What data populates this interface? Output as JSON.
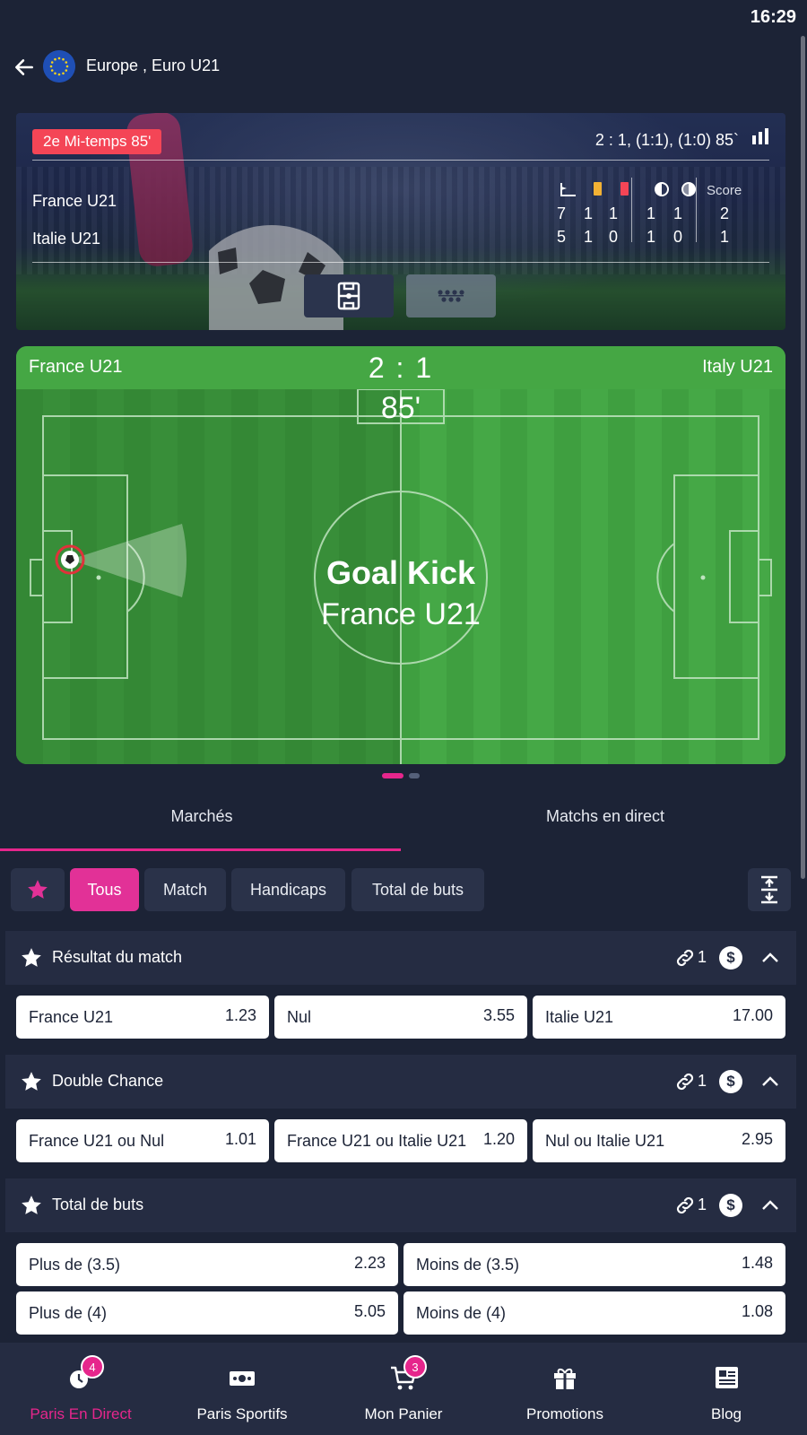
{
  "status_bar": {
    "time": "16:29"
  },
  "nav": {
    "title": "Europe , Euro U21"
  },
  "scoreboard": {
    "period": "2e Mi-temps 85'",
    "score_summary": "2 : 1, (1:1), (1:0) 85`",
    "home_team": "France U21",
    "away_team": "Italie U21",
    "score_header": "Score",
    "home_stats": [
      "7",
      "1",
      "1",
      "1",
      "1",
      "2"
    ],
    "away_stats": [
      "5",
      "1",
      "0",
      "1",
      "0",
      "1"
    ],
    "colors": {
      "period_badge": "#f44556",
      "yellow_card": "#f2b134",
      "red_card": "#f44556"
    }
  },
  "pitch": {
    "home_team": "France U21",
    "away_team": "Italy U21",
    "score": "2 : 1",
    "minute": "85'",
    "event_title": "Goal Kick",
    "event_team": "France U21"
  },
  "tabs": {
    "markets": "Marchés",
    "live_matches": "Matchs en direct"
  },
  "filters": {
    "all": "Tous",
    "match": "Match",
    "handicaps": "Handicaps",
    "total_goals": "Total de buts"
  },
  "markets": [
    {
      "title": "Résultat du match",
      "link_count": "1",
      "odds": [
        {
          "label": "France U21",
          "value": "1.23"
        },
        {
          "label": "Nul",
          "value": "3.55"
        },
        {
          "label": "Italie U21",
          "value": "17.00"
        }
      ]
    },
    {
      "title": "Double Chance",
      "link_count": "1",
      "odds": [
        {
          "label": "France U21 ou Nul",
          "value": "1.01"
        },
        {
          "label": "France U21 ou Italie U21",
          "value": "1.20"
        },
        {
          "label": "Nul ou Italie U21",
          "value": "2.95"
        }
      ]
    },
    {
      "title": "Total de buts",
      "link_count": "1",
      "odds": [
        {
          "label": "Plus de (3.5)",
          "value": "2.23"
        },
        {
          "label": "Moins de (3.5)",
          "value": "1.48"
        },
        {
          "label": "Plus de (4)",
          "value": "5.05"
        },
        {
          "label": "Moins de (4)",
          "value": "1.08"
        }
      ]
    }
  ],
  "bottom_nav": [
    {
      "label": "Paris En Direct",
      "badge": "4",
      "icon": "live-bets-icon"
    },
    {
      "label": "Paris Sportifs",
      "badge": "",
      "icon": "sports-bets-icon"
    },
    {
      "label": "Mon Panier",
      "badge": "3",
      "icon": "cart-icon"
    },
    {
      "label": "Promotions",
      "badge": "",
      "icon": "gift-icon"
    },
    {
      "label": "Blog",
      "badge": "",
      "icon": "newspaper-icon"
    }
  ],
  "accent_color": "#e6268c"
}
